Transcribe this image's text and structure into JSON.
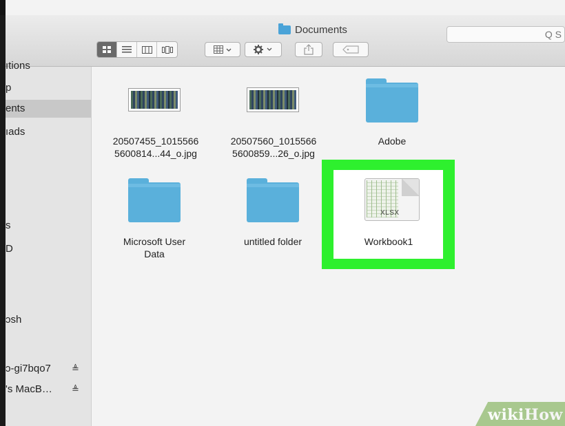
{
  "window": {
    "title": "Documents"
  },
  "toolbar": {
    "view_modes": [
      "icon-view",
      "list-view",
      "column-view",
      "cover-flow-view"
    ],
    "search_label": "Q S"
  },
  "sidebar": {
    "items": [
      {
        "label": "ıtions"
      },
      {
        "label": "p"
      },
      {
        "label": "ents"
      },
      {
        "label": "ıads"
      },
      {
        "label": "s"
      },
      {
        "label": "D"
      },
      {
        "label": "ɔsh"
      },
      {
        "label": "ɔ-gi7bqo7",
        "eject": "≜"
      },
      {
        "label": "'s MacB…",
        "eject": "≜"
      }
    ]
  },
  "files": [
    {
      "line1": "20507455_1015566",
      "line2": "5600814...44_o.jpg",
      "kind": "image"
    },
    {
      "line1": "20507560_1015566",
      "line2": "5600859...26_o.jpg",
      "kind": "image"
    },
    {
      "line1": "Adobe",
      "line2": "",
      "kind": "folder"
    },
    {
      "line1": "Microsoft User",
      "line2": "Data",
      "kind": "folder"
    },
    {
      "line1": "untitled folder",
      "line2": "",
      "kind": "folder"
    },
    {
      "line1": "Workbook1",
      "line2": "",
      "kind": "xlsx",
      "badge": "XLSX"
    }
  ],
  "watermark": {
    "part1": "wiki",
    "part2": "How"
  },
  "colors": {
    "highlight": "#2ef02e",
    "folder": "#5ab0db"
  }
}
